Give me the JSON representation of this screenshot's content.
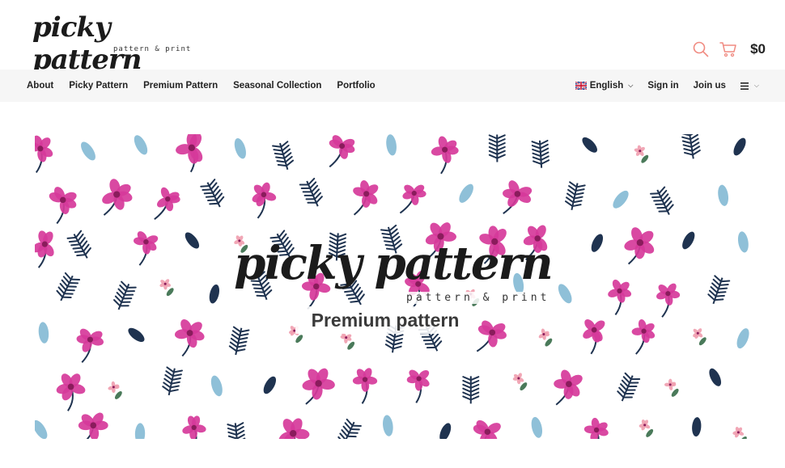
{
  "brand": {
    "name": "picky pattern",
    "tagline": "pattern & print"
  },
  "header": {
    "search_icon": "search-icon",
    "cart_icon": "cart-icon",
    "cart_total": "$0",
    "accent_color": "#f08a80"
  },
  "nav": {
    "items": [
      {
        "label": "About"
      },
      {
        "label": "Picky Pattern"
      },
      {
        "label": "Premium Pattern"
      },
      {
        "label": "Seasonal Collection"
      },
      {
        "label": "Portfolio"
      }
    ],
    "language": "English",
    "sign_in": "Sign in",
    "join_us": "Join us",
    "menu_icon": "hamburger-icon"
  },
  "banner": {
    "title": "picky pattern",
    "tagline": "pattern & print",
    "subtitle": "Premium pattern",
    "colors": {
      "magenta": "#d63a9a",
      "navy": "#1f3350",
      "lightblue": "#8fc0d8",
      "pink": "#f0a0b0",
      "green": "#4a7a5a"
    }
  }
}
